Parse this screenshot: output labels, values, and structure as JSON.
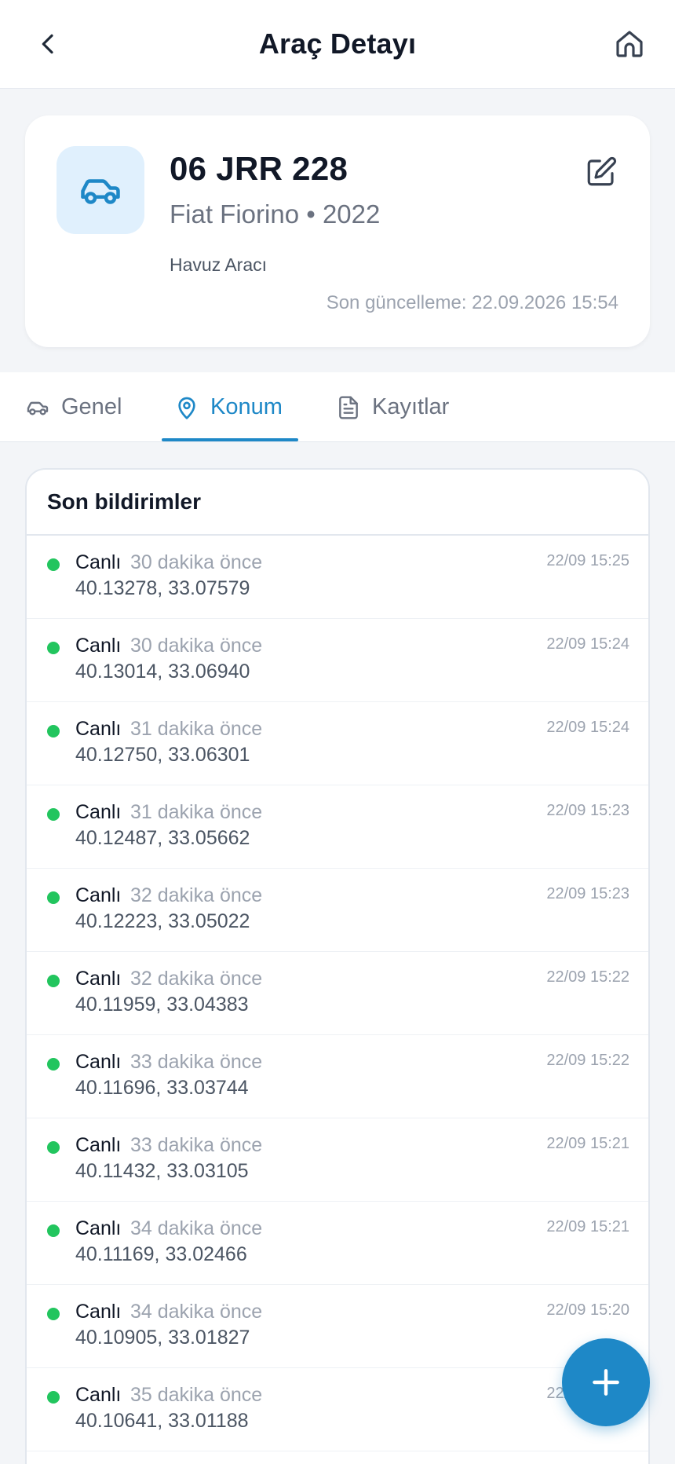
{
  "header": {
    "title": "Araç Detayı"
  },
  "vehicle": {
    "plate": "06 JRR 228",
    "model": "Fiat Fiorino • 2022",
    "type": "Havuz Aracı",
    "updated": "Son güncelleme: 22.09.2026 15:54"
  },
  "tabs": [
    {
      "label": "Genel",
      "icon": "car-icon"
    },
    {
      "label": "Konum",
      "icon": "location-pin-icon"
    },
    {
      "label": "Kayıtlar",
      "icon": "document-icon"
    }
  ],
  "notifications": {
    "title": "Son bildirimler",
    "items": [
      {
        "status": "Canlı",
        "ago": "30 dakika önce",
        "coords": "40.13278, 33.07579",
        "time": "22/09 15:25"
      },
      {
        "status": "Canlı",
        "ago": "30 dakika önce",
        "coords": "40.13014, 33.06940",
        "time": "22/09 15:24"
      },
      {
        "status": "Canlı",
        "ago": "31 dakika önce",
        "coords": "40.12750, 33.06301",
        "time": "22/09 15:24"
      },
      {
        "status": "Canlı",
        "ago": "31 dakika önce",
        "coords": "40.12487, 33.05662",
        "time": "22/09 15:23"
      },
      {
        "status": "Canlı",
        "ago": "32 dakika önce",
        "coords": "40.12223, 33.05022",
        "time": "22/09 15:23"
      },
      {
        "status": "Canlı",
        "ago": "32 dakika önce",
        "coords": "40.11959, 33.04383",
        "time": "22/09 15:22"
      },
      {
        "status": "Canlı",
        "ago": "33 dakika önce",
        "coords": "40.11696, 33.03744",
        "time": "22/09 15:22"
      },
      {
        "status": "Canlı",
        "ago": "33 dakika önce",
        "coords": "40.11432, 33.03105",
        "time": "22/09 15:21"
      },
      {
        "status": "Canlı",
        "ago": "34 dakika önce",
        "coords": "40.11169, 33.02466",
        "time": "22/09 15:21"
      },
      {
        "status": "Canlı",
        "ago": "34 dakika önce",
        "coords": "40.10905, 33.01827",
        "time": "22/09 15:20"
      },
      {
        "status": "Canlı",
        "ago": "35 dakika önce",
        "coords": "40.10641, 33.01188",
        "time": "22/09 15:20"
      }
    ]
  },
  "colors": {
    "accent": "#1e88c7",
    "live_dot": "#22c55e",
    "icon_bg": "#e0f0fd"
  }
}
